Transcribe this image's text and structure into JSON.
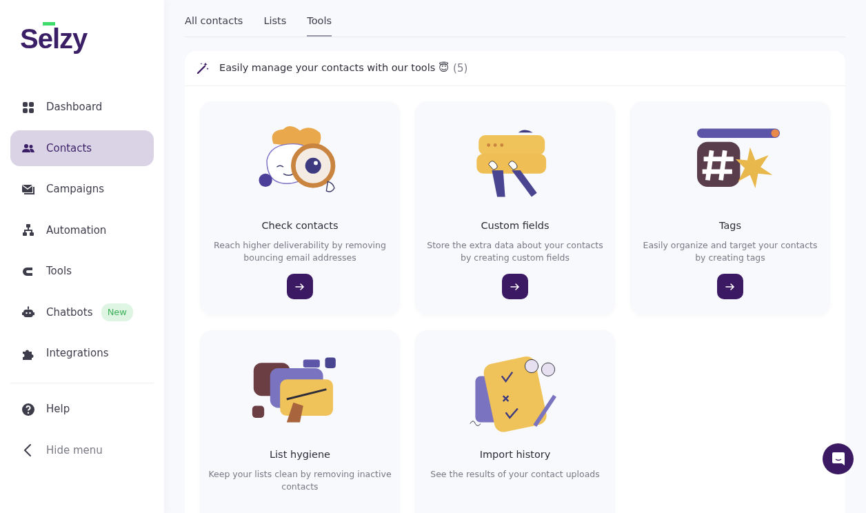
{
  "sidebar": {
    "logo": "Selzy",
    "items": [
      {
        "label": "Dashboard",
        "selected": false
      },
      {
        "label": "Contacts",
        "selected": true
      },
      {
        "label": "Campaigns",
        "selected": false
      },
      {
        "label": "Automation",
        "selected": false
      },
      {
        "label": "Tools",
        "selected": false
      },
      {
        "label": "Chatbots",
        "selected": false,
        "badge": "New"
      },
      {
        "label": "Integrations",
        "selected": false
      }
    ],
    "footer": [
      {
        "label": "Help",
        "kind": "help"
      },
      {
        "label": "Hide menu",
        "kind": "collapse"
      }
    ]
  },
  "tabs": [
    {
      "label": "All contacts",
      "selected": false
    },
    {
      "label": "Lists",
      "selected": false
    },
    {
      "label": "Tools",
      "selected": true
    }
  ],
  "panel": {
    "title": "Easily manage your contacts with our tools 😇",
    "count": "(5)",
    "tools": [
      {
        "title": "Check contacts",
        "description": "Reach higher deliverability by removing bouncing email addresses",
        "button": true
      },
      {
        "title": "Custom fields",
        "description": "Store the extra data about your contacts by creating custom fields",
        "button": true
      },
      {
        "title": "Tags",
        "description": "Easily organize and target your contacts by creating tags",
        "button": true
      },
      {
        "title": "List hygiene",
        "description": "Keep your lists clean by removing inactive contacts"
      },
      {
        "title": "Import history",
        "description": "See the results of your contact uploads"
      }
    ]
  }
}
